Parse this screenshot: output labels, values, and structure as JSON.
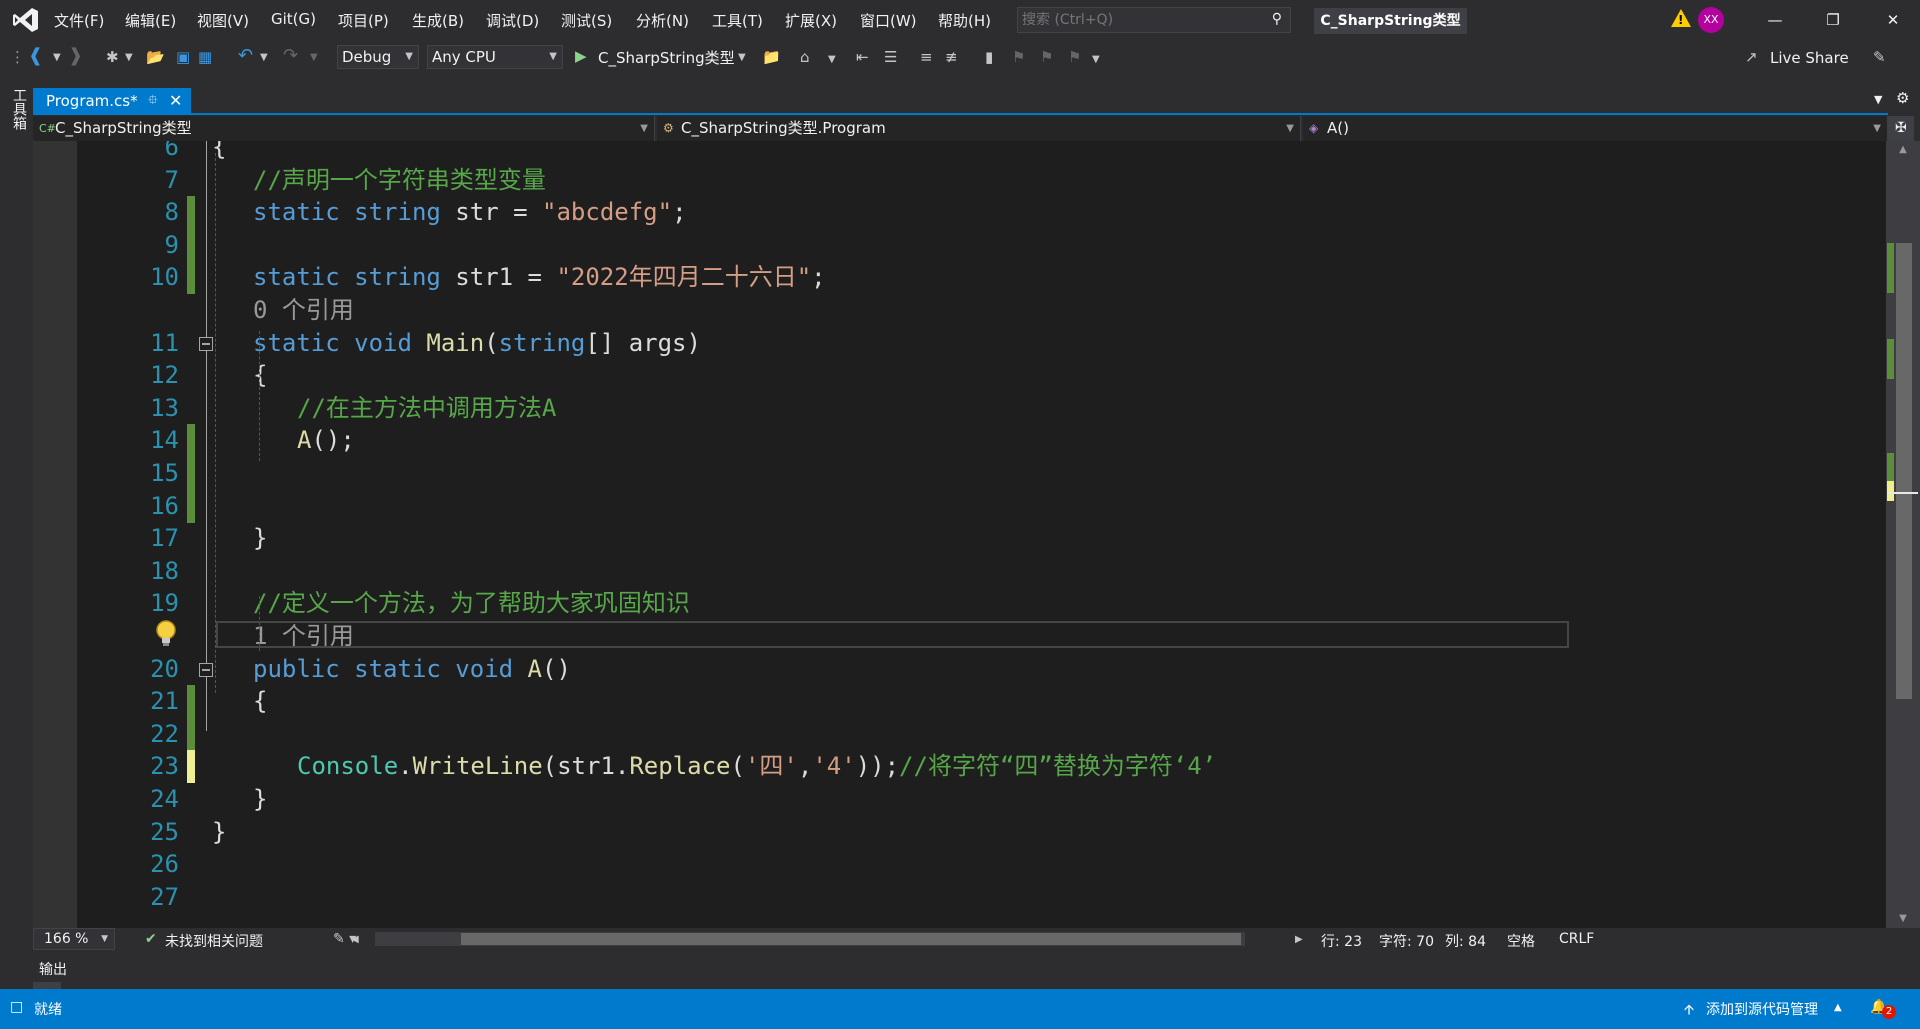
{
  "menu": {
    "items": [
      "文件(F)",
      "编辑(E)",
      "视图(V)",
      "Git(G)",
      "项目(P)",
      "生成(B)",
      "调试(D)",
      "测试(S)",
      "分析(N)",
      "工具(T)",
      "扩展(X)",
      "窗口(W)",
      "帮助(H)"
    ]
  },
  "search": {
    "placeholder": "搜索 (Ctrl+Q)"
  },
  "solution_title": "C_SharpString类型",
  "user": {
    "initials": "XX"
  },
  "toolbar": {
    "config": "Debug",
    "platform": "Any CPU",
    "start_project": "C_SharpString类型",
    "live_share": "Live Share"
  },
  "toolbox": {
    "label": "工具箱"
  },
  "tab": {
    "label": "Program.cs*"
  },
  "nav": {
    "project": "C_SharpString类型",
    "class": "C_SharpString类型.Program",
    "member": "A()"
  },
  "editor": {
    "lines": [
      {
        "num": "6",
        "text": "{"
      },
      {
        "num": "7",
        "comment": "//声明一个字符串类型变量"
      },
      {
        "num": "8",
        "kw": "static string ",
        "id": "str",
        "op": " = ",
        "str": "\"abcdefg\"",
        "end": ";"
      },
      {
        "num": "9"
      },
      {
        "num": "10",
        "kw": "static string ",
        "id": "str1",
        "op": " = ",
        "str": "\"2022年四月二十六日\"",
        "end": ";"
      },
      {
        "ref": "0 个引用"
      },
      {
        "num": "11",
        "kw": "static void ",
        "meth": "Main",
        "p1": "(",
        "kw2": "string",
        "p2": "[] ",
        "id": "args",
        "p3": ")"
      },
      {
        "num": "12",
        "text": "{"
      },
      {
        "num": "13",
        "comment": "//在主方法中调用方法A"
      },
      {
        "num": "14",
        "meth": "A",
        "end": "();"
      },
      {
        "num": "15"
      },
      {
        "num": "16"
      },
      {
        "num": "17",
        "text": "}"
      },
      {
        "num": "18"
      },
      {
        "num": "19",
        "comment": "//定义一个方法，为了帮助大家巩固知识"
      },
      {
        "ref": "1 个引用"
      },
      {
        "num": "20",
        "kw": "public static void ",
        "meth": "A",
        "end": "()"
      },
      {
        "num": "21",
        "text": "{"
      },
      {
        "num": "22"
      },
      {
        "num": "23",
        "cls": "Console",
        "dot": ".",
        "meth": "WriteLine",
        "a": "(str1.",
        "meth2": "Replace",
        "b": "(",
        "s1": "'四'",
        "c": ",",
        "s2": "'4'",
        "d": "));",
        "comment": "//将字符“四”替换为字符‘4’"
      },
      {
        "num": "24",
        "text": "}"
      },
      {
        "num": "25",
        "text": "}"
      },
      {
        "num": "26"
      },
      {
        "num": "27"
      }
    ]
  },
  "editor_status": {
    "zoom": "166 %",
    "issues": "未找到相关问题",
    "line": "行: 23",
    "char": "字符: 70",
    "col": "列: 84",
    "whitespace": "空格",
    "eol": "CRLF"
  },
  "output": {
    "label": "输出"
  },
  "statusbar": {
    "ready": "就绪",
    "source_control": "添加到源代码管理",
    "notifications": "2"
  },
  "colors": {
    "accent": "#007acc",
    "keyword": "#569cd6",
    "string": "#d69d85",
    "comment": "#57a64a",
    "method": "#dcdcaa",
    "class": "#4ec9b0",
    "line_number": "#2b91af",
    "change_saved": "#5c8d3b",
    "change_unsaved": "#efef91"
  }
}
